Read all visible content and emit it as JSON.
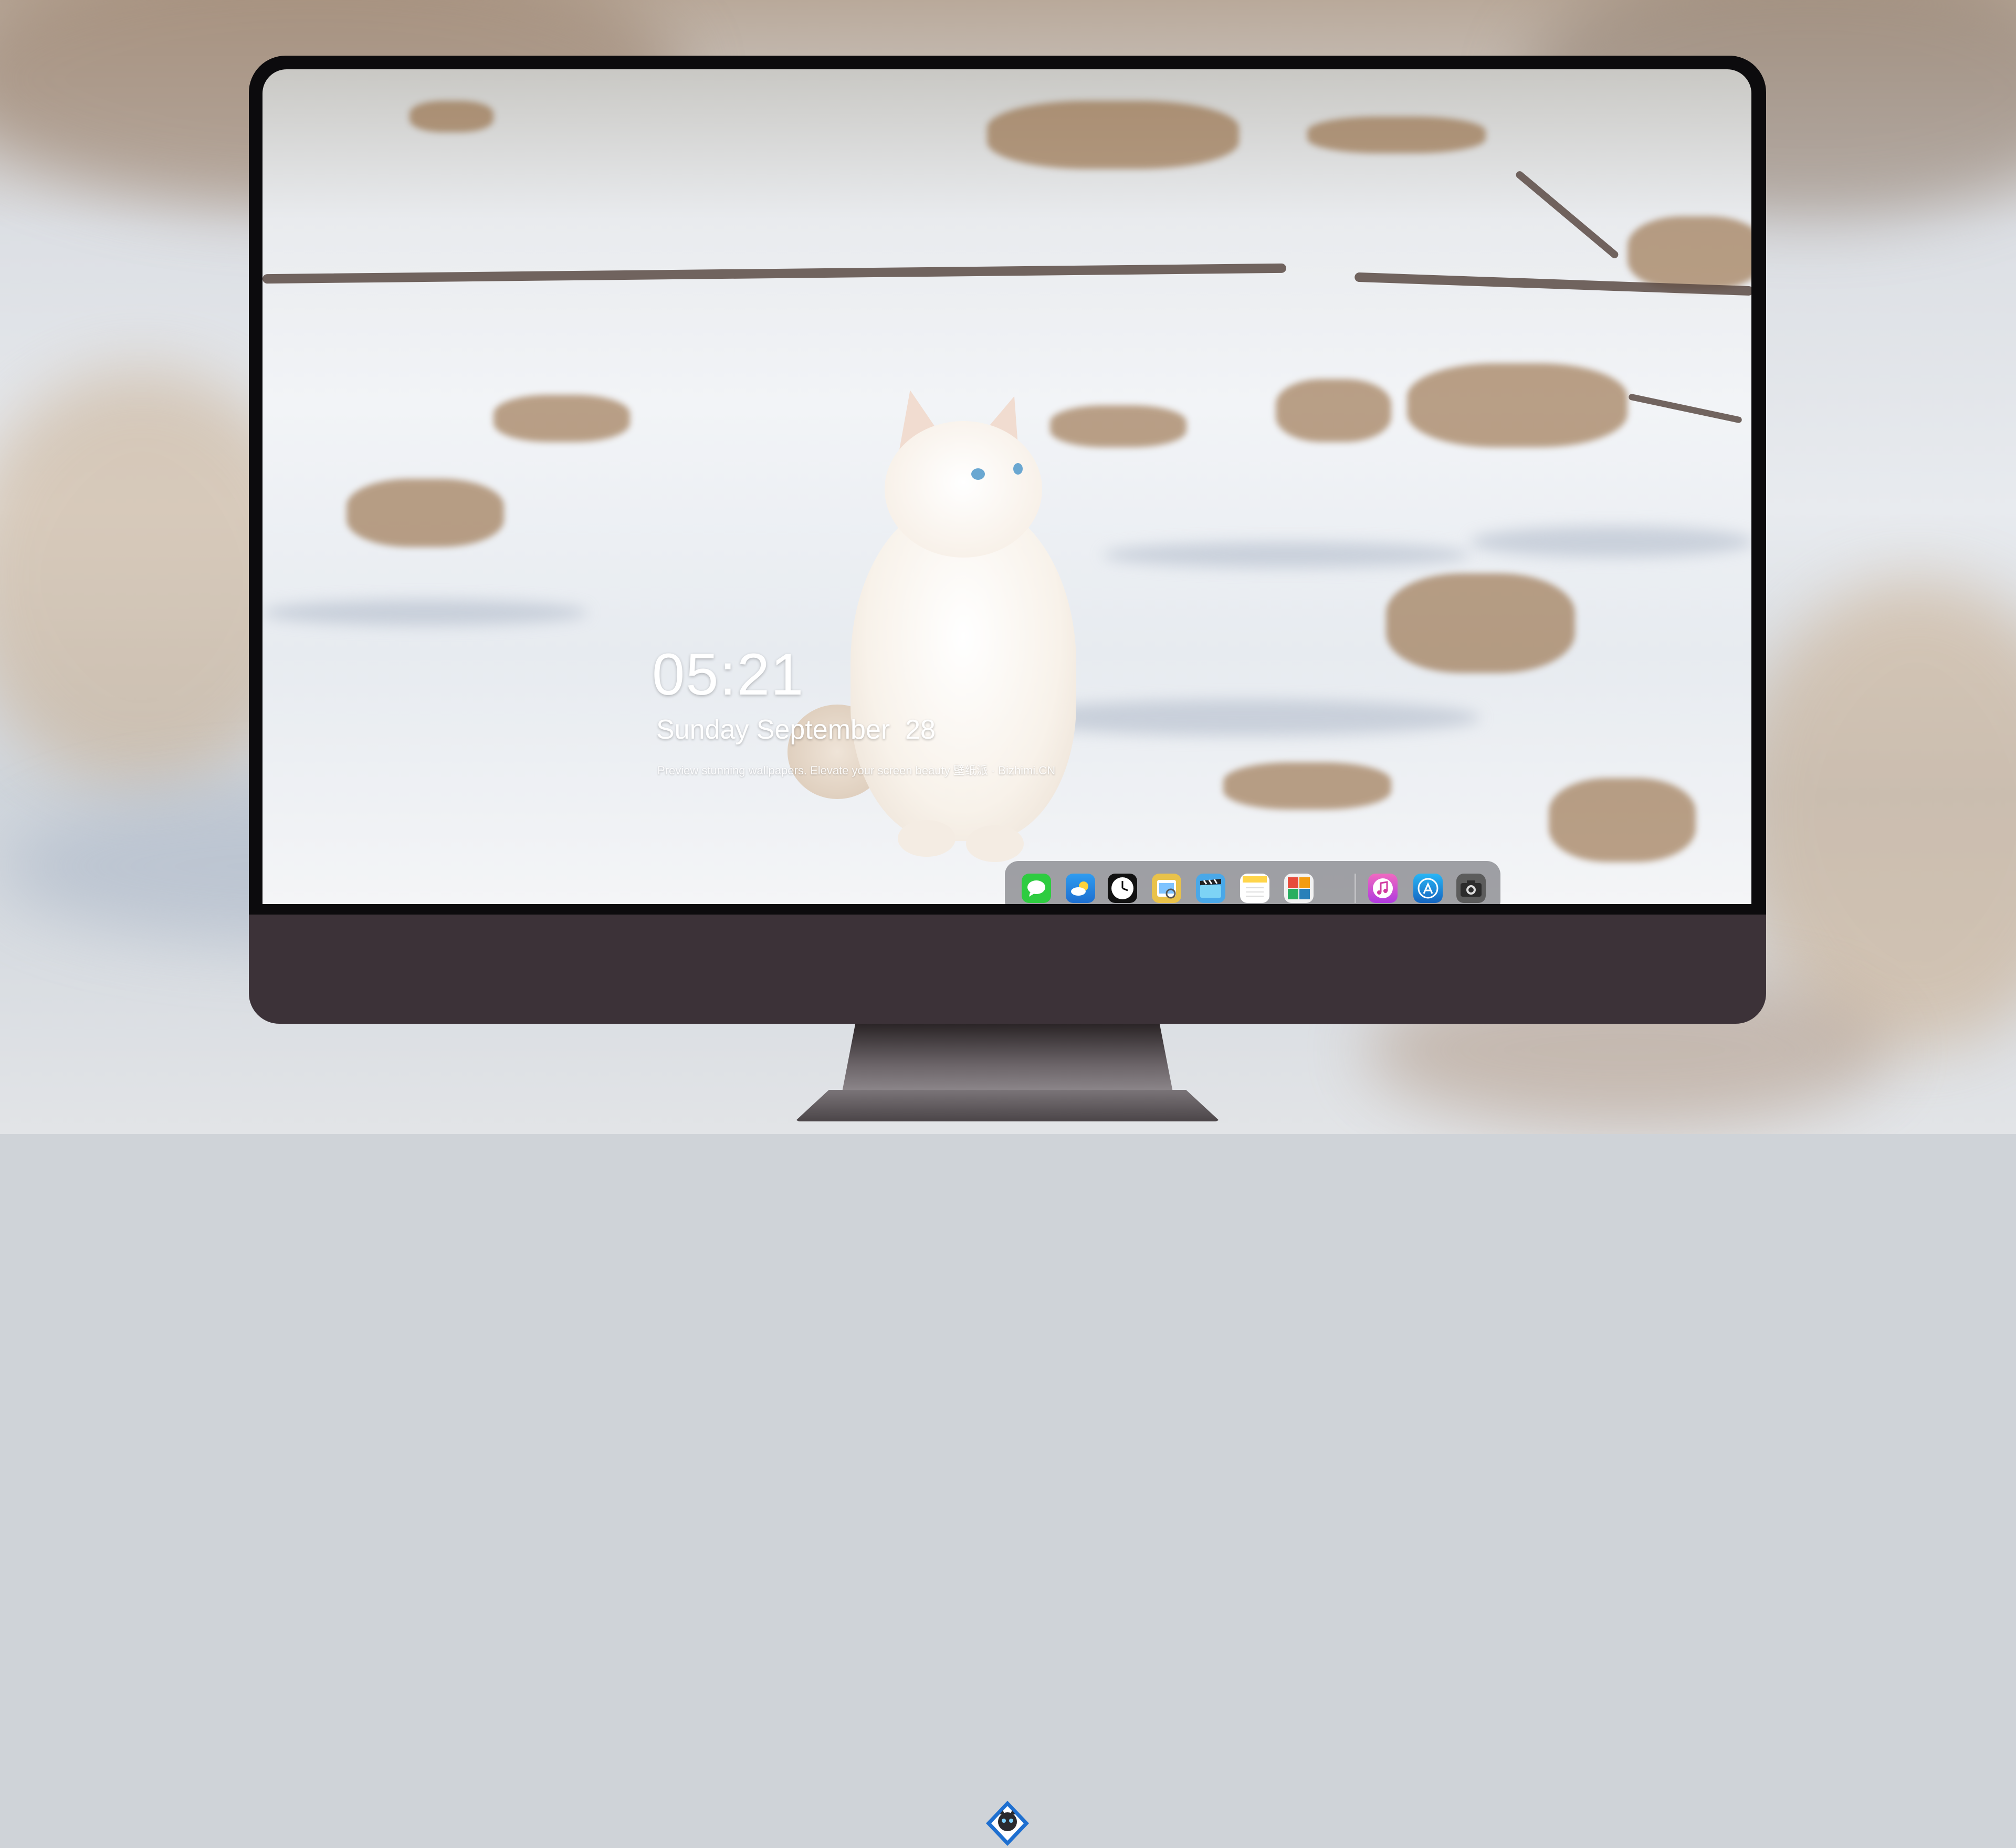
{
  "lock_screen": {
    "time": "05:21",
    "date": "Sunday September  28",
    "caption": "Preview stunning wallpapers. Elevate your screen beauty  壁纸派  ·  Bizhimi.CN"
  },
  "dock": {
    "apps": [
      {
        "name": "messages-icon",
        "color": "#2ecc40"
      },
      {
        "name": "weather-icon",
        "color": "#2f9cf0"
      },
      {
        "name": "clock-icon",
        "color": "#111111"
      },
      {
        "name": "preview-icon",
        "color": "#e9c24a"
      },
      {
        "name": "clips-icon",
        "color": "#4aa8e8"
      },
      {
        "name": "notes-icon",
        "color": "#ffd54a"
      },
      {
        "name": "photo-booth-icon",
        "color": "#e74c3c"
      },
      {
        "name": "music-icon",
        "color": "#e040a0"
      },
      {
        "name": "app-store-icon",
        "color": "#1e88e5"
      },
      {
        "name": "camera-icon",
        "color": "#555555"
      }
    ]
  },
  "colors": {
    "monitor_chin": "#3c3238",
    "bezel": "#0c0b0d",
    "dock_bg": "rgba(90,90,96,.55)"
  }
}
